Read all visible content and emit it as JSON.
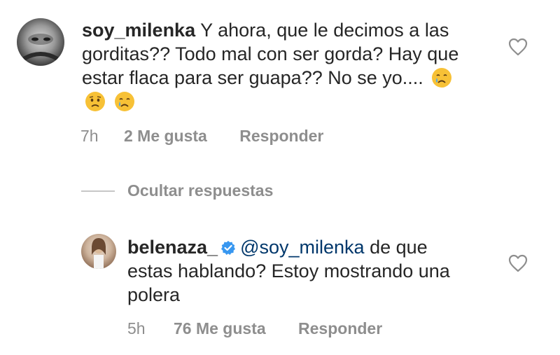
{
  "comment1": {
    "username": "soy_milenka",
    "text": "Y ahora, que le decimos a las gorditas?? Todo mal con ser gorda? Hay que estar flaca para ser guapa?? No se yo....",
    "emojis": [
      "crying-face-emoji",
      "sad-face-emoji",
      "crying-face-emoji"
    ],
    "time": "7h",
    "likes": "2 Me gusta",
    "reply": "Responder"
  },
  "hide_replies": "Ocultar respuestas",
  "comment2": {
    "username": "belenaza_",
    "verified": true,
    "mention": "@soy_milenka",
    "text": "de que estas hablando? Estoy mostrando una polera",
    "time": "5h",
    "likes": "76 Me gusta",
    "reply": "Responder"
  },
  "colors": {
    "text": "#262626",
    "secondary": "#8e8e8e",
    "mention": "#00376b",
    "verified": "#3897f0"
  }
}
